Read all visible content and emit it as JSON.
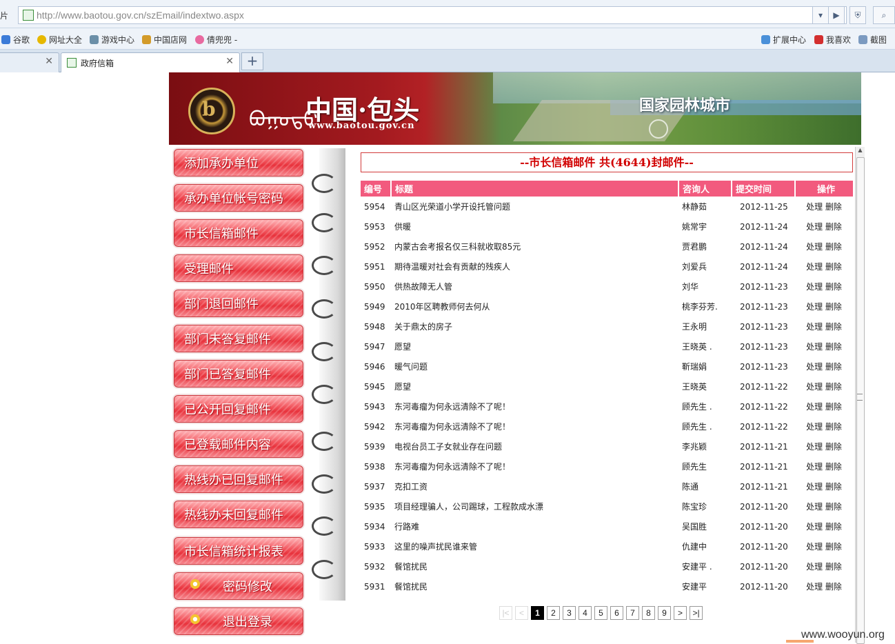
{
  "browser": {
    "left_label": "片",
    "url": "http://www.baotou.gov.cn/szEmail/indextwo.aspx",
    "bookmarks": [
      "谷歌",
      "网址大全",
      "游戏中心",
      "中国店网",
      "倩兜兜 -"
    ],
    "bookmarks_right": [
      "扩展中心",
      "我喜欢",
      "截图"
    ],
    "tabs": [
      {
        "label": ""
      },
      {
        "label": "政府信箱"
      }
    ],
    "new_tab": "+"
  },
  "banner": {
    "title": "中国·包头",
    "mongolian": "ᠪᠤᠭᠤᠲᠤ",
    "url": "www.baotou.gov.cn",
    "slogan": "国家园林城市",
    "logo_glyph": "b"
  },
  "menu": {
    "items": [
      {
        "label": "添加承办单位"
      },
      {
        "label": "承办单位帐号密码"
      },
      {
        "label": "市长信箱邮件"
      },
      {
        "label": "受理邮件"
      },
      {
        "label": "部门退回邮件"
      },
      {
        "label": "部门未答复邮件"
      },
      {
        "label": "部门已答复邮件"
      },
      {
        "label": "已公开回复邮件"
      },
      {
        "label": "已登载邮件内容"
      },
      {
        "label": "热线办已回复邮件"
      },
      {
        "label": "热线办未回复邮件"
      },
      {
        "label": "市长信箱统计报表"
      },
      {
        "label": "密码修改",
        "icon": "gear-icon"
      },
      {
        "label": "退出登录",
        "icon": "gear-icon"
      }
    ]
  },
  "content": {
    "title": "--市长信箱邮件 共(4644)封邮件--",
    "columns": [
      "编号",
      "标题",
      "咨询人",
      "提交时间",
      "操作"
    ],
    "action_process": "处理",
    "action_delete": "删除",
    "rows": [
      {
        "id": "5954",
        "title": "青山区光荣道小学开设托管问题",
        "name": "林静茹",
        "date": "2012-11-25"
      },
      {
        "id": "5953",
        "title": "供暖",
        "name": "姚常宇",
        "date": "2012-11-24"
      },
      {
        "id": "5952",
        "title": "内蒙古会考报名仅三科就收取85元",
        "name": "贾君鹏",
        "date": "2012-11-24"
      },
      {
        "id": "5951",
        "title": "期待温暖对社会有贡献的残疾人",
        "name": "刘爱兵",
        "date": "2012-11-24"
      },
      {
        "id": "5950",
        "title": "供热故障无人管",
        "name": "刘华",
        "date": "2012-11-23"
      },
      {
        "id": "5949",
        "title": "2010年区聘教师何去何从",
        "name": "桃李芬芳.",
        "date": "2012-11-23"
      },
      {
        "id": "5948",
        "title": "关于鼎太的房子",
        "name": "王永明",
        "date": "2012-11-23"
      },
      {
        "id": "5947",
        "title": "愿望",
        "name": "王晓英 .",
        "date": "2012-11-23"
      },
      {
        "id": "5946",
        "title": "暖气问题",
        "name": "靳瑞娟",
        "date": "2012-11-23"
      },
      {
        "id": "5945",
        "title": "愿望",
        "name": "王晓英",
        "date": "2012-11-22"
      },
      {
        "id": "5943",
        "title": "东河毒瘤为何永远清除不了呢！",
        "name": "顾先生 .",
        "date": "2012-11-22"
      },
      {
        "id": "5942",
        "title": "东河毒瘤为何永远清除不了呢！",
        "name": "顾先生 .",
        "date": "2012-11-22"
      },
      {
        "id": "5939",
        "title": "电视台员工子女就业存在问题",
        "name": "李兆颖",
        "date": "2012-11-21"
      },
      {
        "id": "5938",
        "title": "东河毒瘤为何永远清除不了呢！",
        "name": "顾先生",
        "date": "2012-11-21"
      },
      {
        "id": "5937",
        "title": "克扣工资",
        "name": "陈通",
        "date": "2012-11-21"
      },
      {
        "id": "5935",
        "title": "项目经理骗人，公司踢球，工程款成水漂",
        "name": "陈宝珍",
        "date": "2012-11-20"
      },
      {
        "id": "5934",
        "title": "行路难",
        "name": "吴国胜",
        "date": "2012-11-20"
      },
      {
        "id": "5933",
        "title": "这里的噪声扰民谁来管",
        "name": "仇建中",
        "date": "2012-11-20"
      },
      {
        "id": "5932",
        "title": "餐馆扰民",
        "name": "安建平 .",
        "date": "2012-11-20"
      },
      {
        "id": "5931",
        "title": "餐馆扰民",
        "name": "安建平",
        "date": "2012-11-20"
      }
    ]
  },
  "pager": {
    "first": "|<",
    "prev": "<",
    "next": ">",
    "last": ">|",
    "pages": [
      "1",
      "2",
      "3",
      "4",
      "5",
      "6",
      "7",
      "8",
      "9"
    ],
    "current": "1"
  },
  "watermark": "www.wooyun.org",
  "colors": {
    "accent": "#f25a7e",
    "title_red": "#d10000",
    "menu_red": "#e8323c"
  }
}
